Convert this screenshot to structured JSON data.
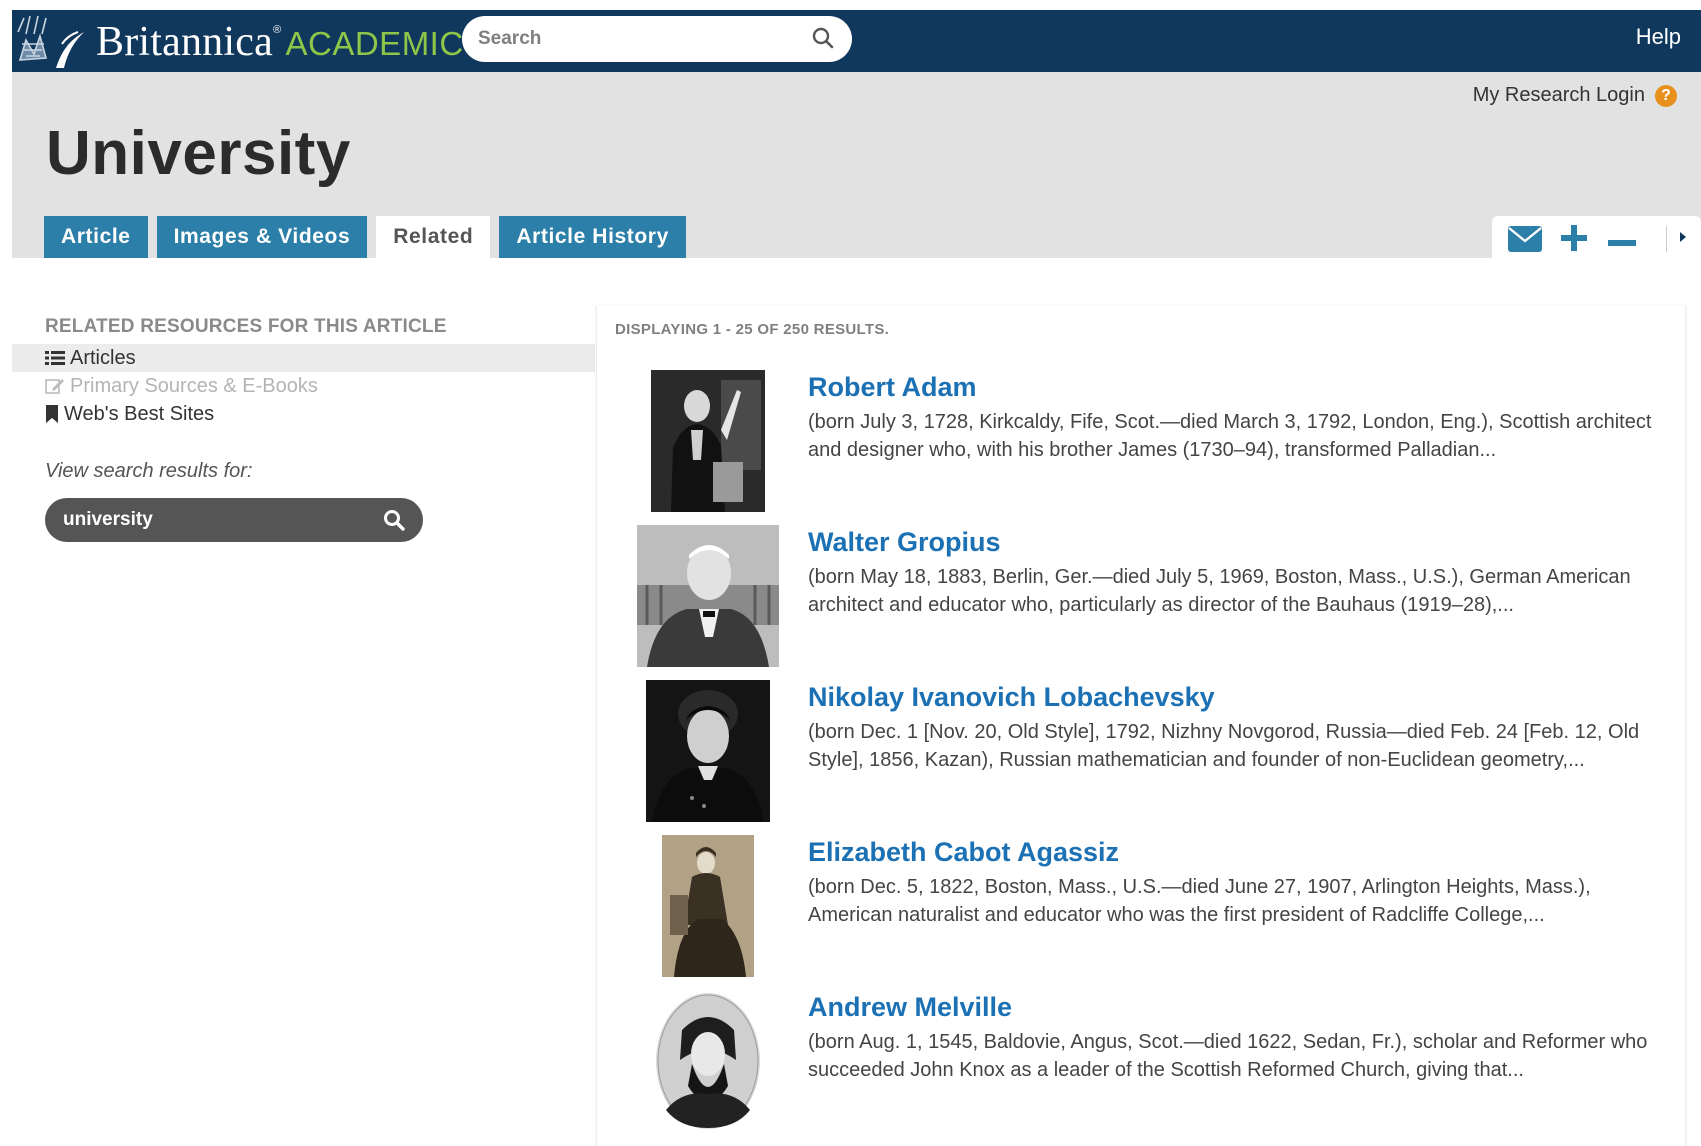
{
  "app": {
    "brand_main": "Britannica",
    "brand_registered": "®",
    "brand_sub": "ACADEMIC",
    "brand_color": "#8ec64a",
    "nav_color": "#10375c",
    "search_placeholder": "Search",
    "search_icon": "magnifier-icon",
    "help_label": "Help"
  },
  "header": {
    "research_login_label": "My Research Login",
    "research_help_glyph": "?",
    "page_title": "University",
    "tabs": [
      {
        "label": "Article",
        "active": false
      },
      {
        "label": "Images & Videos",
        "active": false
      },
      {
        "label": "Related",
        "active": true
      },
      {
        "label": "Article History",
        "active": false
      }
    ],
    "tab_color": "#2b7fa8",
    "tools": [
      "envelope-icon",
      "plus-icon",
      "minus-icon",
      "caret-right-icon"
    ]
  },
  "sidebar": {
    "heading": "RELATED RESOURCES FOR THIS ARTICLE",
    "items": [
      {
        "label": "Articles",
        "icon": "list-icon",
        "state": "active"
      },
      {
        "label": "Primary Sources & E-Books",
        "icon": "edit-icon",
        "state": "disabled"
      },
      {
        "label": "Web's Best Sites",
        "icon": "bookmark-icon",
        "state": "normal"
      }
    ],
    "view_label": "View search results for:",
    "search_value": "university"
  },
  "results": {
    "count_text": "DISPLAYING 1 - 25 OF 250 RESULTS.",
    "items": [
      {
        "title": "Robert Adam",
        "snippet": "(born July 3, 1728, Kirkcaldy, Fife, Scot.—died March 3, 1792, London, Eng.), Scottish architect and designer who, with his brother James (1730–94), transformed Palladian...",
        "thumb": "portrait-robert-adam"
      },
      {
        "title": "Walter Gropius",
        "snippet": "(born May 18, 1883, Berlin, Ger.—died July 5, 1969, Boston, Mass., U.S.), German American architect and educator who, particularly as director of the Bauhaus (1919–28),...",
        "thumb": "portrait-walter-gropius"
      },
      {
        "title": "Nikolay Ivanovich Lobachevsky",
        "snippet": "(born Dec. 1 [Nov. 20, Old Style], 1792, Nizhny Novgorod, Russia—died Feb. 24 [Feb. 12, Old Style], 1856, Kazan), Russian mathematician and founder of non-Euclidean geometry,...",
        "thumb": "portrait-lobachevsky"
      },
      {
        "title": "Elizabeth Cabot Agassiz",
        "snippet": "(born Dec. 5, 1822, Boston, Mass., U.S.—died June 27, 1907, Arlington Heights, Mass.), American naturalist and educator who was the first president of Radcliffe College,...",
        "thumb": "portrait-elizabeth-agassiz"
      },
      {
        "title": "Andrew Melville",
        "snippet": "(born Aug. 1, 1545, Baldovie, Angus, Scot.—died 1622, Sedan, Fr.), scholar and Reformer who succeeded John Knox as a leader of the Scottish Reformed Church, giving that...",
        "thumb": "portrait-andrew-melville"
      }
    ]
  }
}
